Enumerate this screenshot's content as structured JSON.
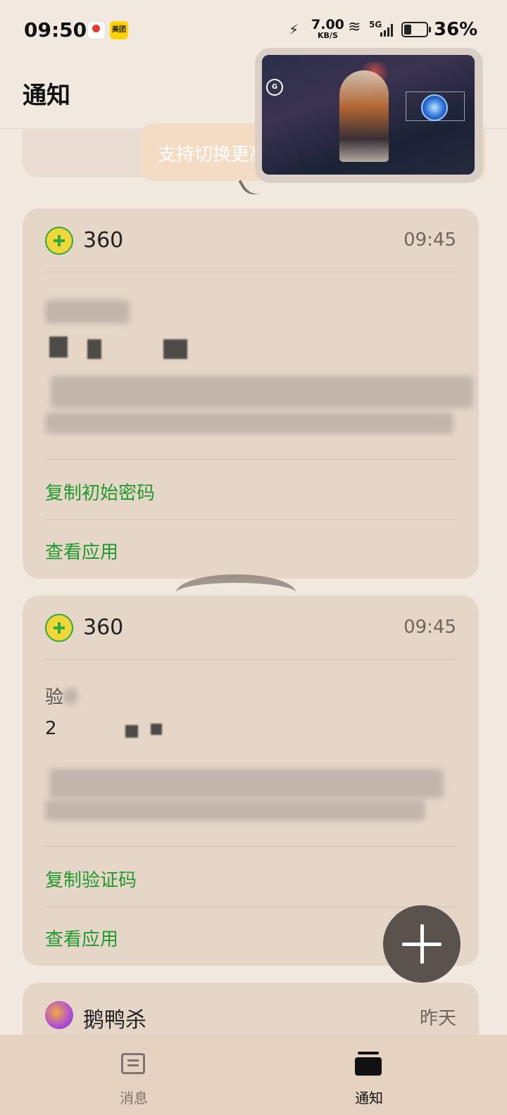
{
  "status_bar": {
    "time": "09:50",
    "app_icon_2_text": "美团",
    "net_speed": "7.00",
    "net_speed_unit": "KB/S",
    "signal_label": "5G",
    "battery": "36%",
    "battery_level": 0.36
  },
  "header": {
    "title": "通知"
  },
  "tooltip": {
    "text": "支持切换更高"
  },
  "cards": [
    {
      "app": "360",
      "time": "09:45",
      "action_1": "复制初始密码",
      "action_2": "查看应用"
    },
    {
      "app": "360",
      "time": "09:45",
      "body_start": "验",
      "body_line2_start": "2",
      "action_1": "复制验证码",
      "action_2": "查看应用"
    },
    {
      "app": "鹅鸭杀",
      "time": "昨天"
    }
  ],
  "bottom_nav": {
    "messages": "消息",
    "notifications": "通知",
    "active_color": "#111111",
    "inactive_color": "#7d756f"
  },
  "accent_color": "#1f9a2c"
}
